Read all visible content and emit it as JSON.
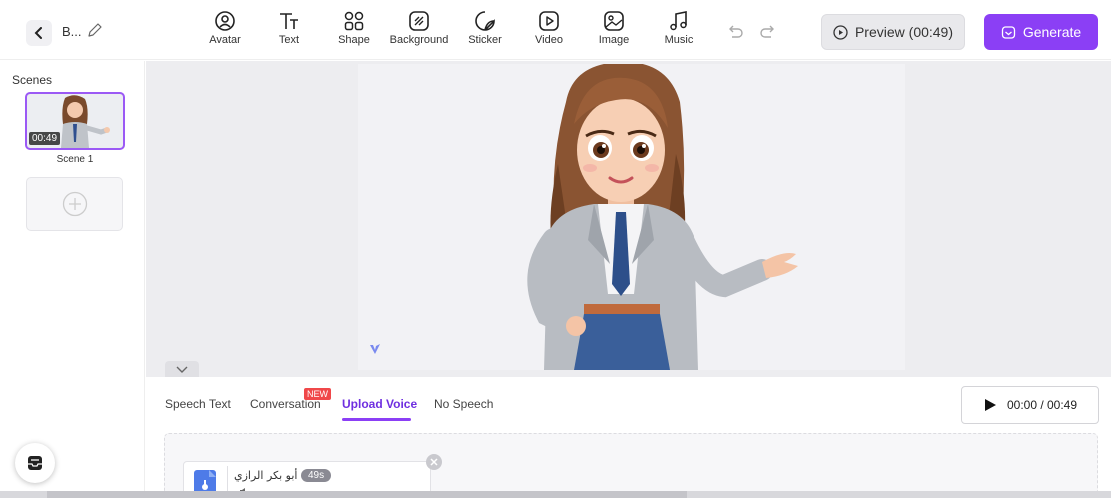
{
  "header": {
    "project_name": "B...",
    "tools": [
      {
        "id": "avatar",
        "label": "Avatar",
        "icon": "avatar-icon"
      },
      {
        "id": "text",
        "label": "Text",
        "icon": "text-icon"
      },
      {
        "id": "shape",
        "label": "Shape",
        "icon": "shape-icon"
      },
      {
        "id": "background",
        "label": "Background",
        "icon": "background-icon"
      },
      {
        "id": "sticker",
        "label": "Sticker",
        "icon": "sticker-icon"
      },
      {
        "id": "video",
        "label": "Video",
        "icon": "video-icon"
      },
      {
        "id": "image",
        "label": "Image",
        "icon": "image-icon"
      },
      {
        "id": "music",
        "label": "Music",
        "icon": "music-icon"
      }
    ],
    "preview_label": "Preview (00:49)",
    "generate_label": "Generate",
    "accent_color": "#8b3ff5"
  },
  "scenes": {
    "title": "Scenes",
    "items": [
      {
        "label": "Scene 1",
        "duration": "00:49",
        "selected": true
      }
    ]
  },
  "speech_panel": {
    "tabs": [
      {
        "label": "Speech Text",
        "active": false
      },
      {
        "label": "Conversation",
        "active": false,
        "badge": "NEW"
      },
      {
        "label": "Upload Voice",
        "active": true
      },
      {
        "label": "No Speech",
        "active": false
      }
    ],
    "playback": "00:00 / 00:49",
    "voice_file": {
      "name": "أبو بكر الرازي",
      "duration": "49s"
    }
  }
}
